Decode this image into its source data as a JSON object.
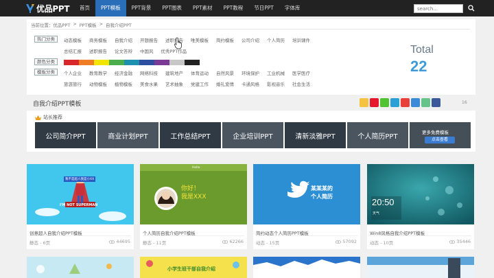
{
  "header": {
    "logo_text": "优品PPT",
    "nav": [
      "首页",
      "PPT模板",
      "PPT背景",
      "PPT图表",
      "PPT素材",
      "PPT教程",
      "节日PPT",
      "字体库"
    ],
    "active_index": 1,
    "search_placeholder": "search..."
  },
  "breadcrumb": [
    "当前位置：优品PPT",
    ">",
    "PPT模板",
    ">",
    "自我介绍PPT"
  ],
  "filters": {
    "hot_label": "热门分类",
    "hot_row1": [
      "动态模板",
      "商务模板",
      "自我介绍",
      "开题报告",
      "述职报告",
      "唯美模板",
      "简约模板",
      "公司介绍",
      "个人简历",
      "培训课件"
    ],
    "hot_row2": [
      "总结汇报",
      "述职报告",
      "论文答辩",
      "中国风",
      "优秀PPT作品"
    ],
    "color_label": "颜色分类",
    "colors": [
      "#d9282b",
      "#f07d23",
      "#f2e600",
      "#4cae4c",
      "#1e90b0",
      "#2e4fa0",
      "#7b3a96",
      "#c7c7c7",
      "#222222"
    ],
    "template_label": "模板分类",
    "template_row1": [
      "个人企业",
      "教育教学",
      "经济金融",
      "网络科技",
      "建筑地产",
      "体育运动",
      "自然风景",
      "环境保护",
      "工业机械",
      "医学医疗"
    ],
    "template_row2": [
      "旅游旅行",
      "动物模板",
      "植物模板",
      "美食水果",
      "艺术抽象",
      "党建工作",
      "婚礼爱情",
      "卡通风格",
      "影视音乐",
      "社会生活"
    ]
  },
  "total": {
    "label": "Total",
    "value": "22"
  },
  "section_title": "自我介绍PPT模板",
  "share_count": "16",
  "recommend": {
    "title": "站长推荐",
    "items": [
      "公司简介PPT",
      "商业计划PPT",
      "工作总结PPT",
      "企业培训PPT",
      "清新淡雅PPT",
      "个人简历PPT"
    ],
    "more_label": "更多免费模板",
    "more_button": "点击查看"
  },
  "cards": [
    {
      "title": "创意超人自我介绍PPT模板",
      "meta": "静态 - 6页",
      "views": "44695",
      "img_text": "I'M NOT SUPERMAN",
      "img_caption": "我不是超人我是小XX"
    },
    {
      "title": "个人简历自我介绍PPT模板",
      "meta": "静态 - 11页",
      "views": "62266",
      "img_text": "你好！",
      "img_caption": "我是XXX",
      "img_tag": "Hello"
    },
    {
      "title": "简约动态个人简历PPT模板",
      "meta": "动态 - 15页",
      "views": "57092",
      "img_text": "某某某的",
      "img_caption": "个人简历"
    },
    {
      "title": "Win8风格自我介绍PPT模板",
      "meta": "动态 - 10页",
      "views": "35446",
      "img_text": "20:50",
      "img_caption": "天气"
    }
  ],
  "bottom_cards": [
    {
      "img_text": ""
    },
    {
      "img_text": "小学生班干部自我介绍"
    },
    {
      "img_text": ""
    },
    {
      "img_text": ""
    }
  ]
}
